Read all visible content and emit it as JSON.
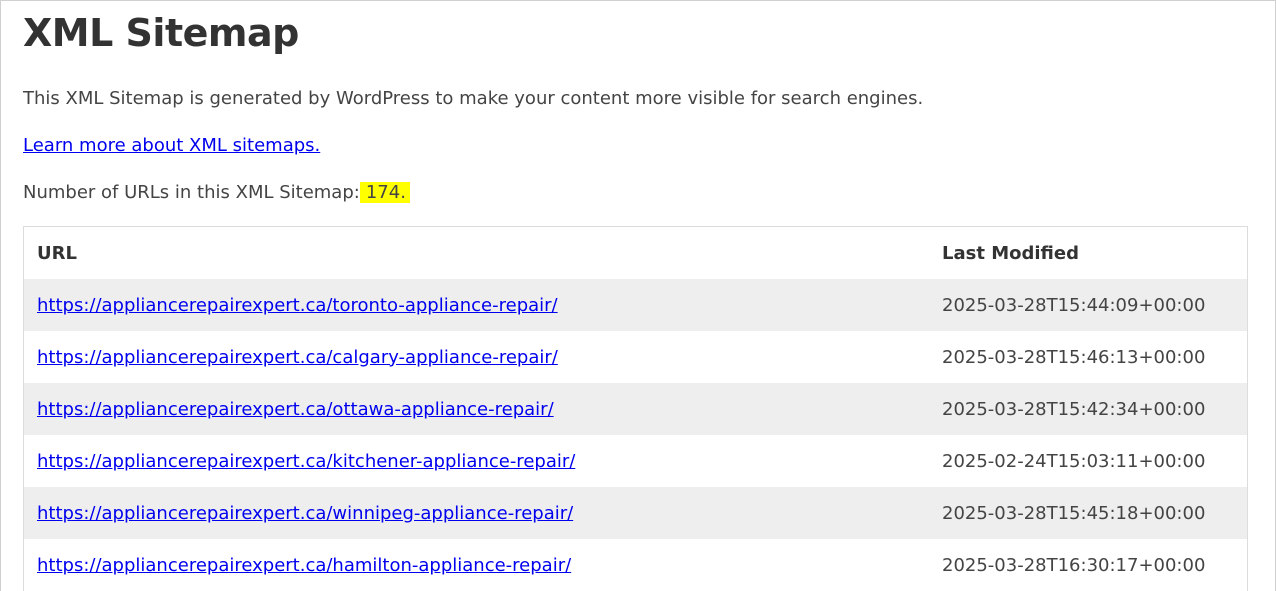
{
  "page": {
    "title": "XML Sitemap",
    "description": "This XML Sitemap is generated by WordPress to make your content more visible for search engines.",
    "learn_more_link": "Learn more about XML sitemaps.",
    "count_label": "Number of URLs in this XML Sitemap:",
    "count_value": "174.",
    "highlight_color": "#ffff00",
    "link_color": "#0000ee"
  },
  "table": {
    "headers": {
      "url": "URL",
      "last_modified": "Last Modified"
    },
    "rows": [
      {
        "url": "https://appliancerepairexpert.ca/toronto-appliance-repair/",
        "last_modified": "2025-03-28T15:44:09+00:00"
      },
      {
        "url": "https://appliancerepairexpert.ca/calgary-appliance-repair/",
        "last_modified": "2025-03-28T15:46:13+00:00"
      },
      {
        "url": "https://appliancerepairexpert.ca/ottawa-appliance-repair/",
        "last_modified": "2025-03-28T15:42:34+00:00"
      },
      {
        "url": "https://appliancerepairexpert.ca/kitchener-appliance-repair/",
        "last_modified": "2025-02-24T15:03:11+00:00"
      },
      {
        "url": "https://appliancerepairexpert.ca/winnipeg-appliance-repair/",
        "last_modified": "2025-03-28T15:45:18+00:00"
      },
      {
        "url": "https://appliancerepairexpert.ca/hamilton-appliance-repair/",
        "last_modified": "2025-03-28T16:30:17+00:00"
      }
    ]
  }
}
